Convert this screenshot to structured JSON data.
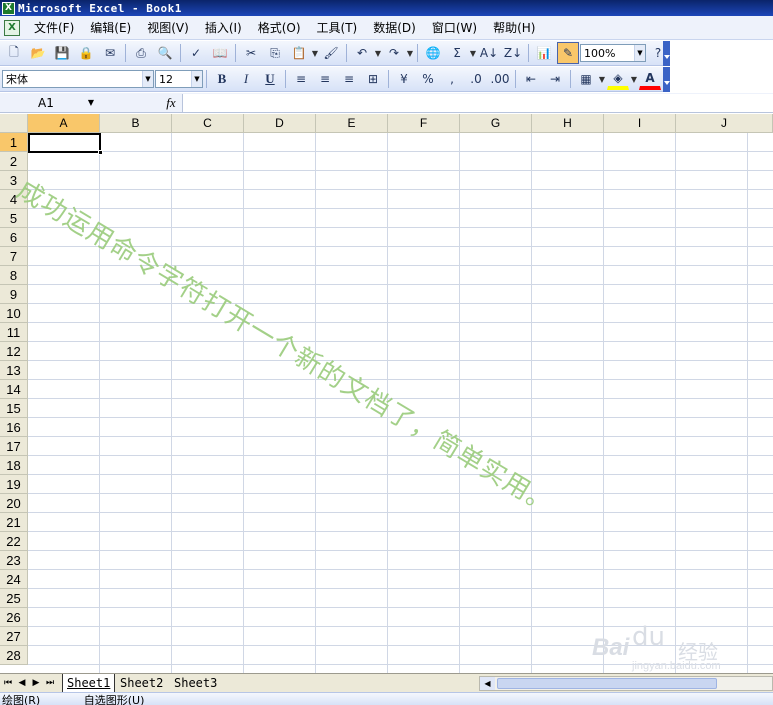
{
  "window": {
    "app_icon": "excel-icon",
    "title": "Microsoft Excel - Book1"
  },
  "menubar": {
    "doc_icon": "workbook-icon",
    "items": [
      "文件(F)",
      "编辑(E)",
      "视图(V)",
      "插入(I)",
      "格式(O)",
      "工具(T)",
      "数据(D)",
      "窗口(W)",
      "帮助(H)"
    ]
  },
  "standard_toolbar": {
    "zoom": "100%",
    "icons": [
      "new-icon",
      "open-icon",
      "save-icon",
      "permission-icon",
      "email-icon",
      "print-icon",
      "print-preview-icon",
      "spelling-icon",
      "research-icon",
      "cut-icon",
      "copy-icon",
      "paste-icon",
      "format-painter-icon",
      "undo-icon",
      "redo-icon",
      "hyperlink-icon",
      "autosum-icon",
      "sort-ascending-icon",
      "sort-descending-icon",
      "chart-wizard-icon",
      "drawing-icon",
      "help-icon"
    ]
  },
  "format_toolbar": {
    "font_name": "宋体",
    "font_size": "12",
    "bold": "B",
    "italic": "I",
    "underline": "U",
    "icons": [
      "align-left-icon",
      "align-center-icon",
      "align-right-icon",
      "merge-center-icon",
      "currency-icon",
      "percent-icon",
      "comma-icon",
      "increase-decimal-icon",
      "decrease-decimal-icon",
      "decrease-indent-icon",
      "increase-indent-icon",
      "borders-icon",
      "fill-color-icon",
      "font-color-icon"
    ],
    "fill_color": "#ffff00",
    "font_color": "#ff0000"
  },
  "formula_bar": {
    "name_box": "A1",
    "fx_label": "fx",
    "content": ""
  },
  "grid": {
    "columns": [
      "A",
      "B",
      "C",
      "D",
      "E",
      "F",
      "G",
      "H",
      "I",
      "J"
    ],
    "rows": [
      "1",
      "2",
      "3",
      "4",
      "5",
      "6",
      "7",
      "8",
      "9",
      "10",
      "11",
      "12",
      "13",
      "14",
      "15",
      "16",
      "17",
      "18",
      "19",
      "20",
      "21",
      "22",
      "23",
      "24",
      "25",
      "26",
      "27",
      "28"
    ],
    "active_cell": "A1"
  },
  "watermark_text": "成功运用命令字符打开一个新的文档了，简单实用。",
  "sheet_tabs": [
    "Sheet1",
    "Sheet2",
    "Sheet3"
  ],
  "active_sheet": "Sheet1",
  "drawing_toolbar": {
    "draw_label": "绘图(R)",
    "autoshapes_label": "自选图形(U)"
  },
  "baidu_watermark": {
    "logo": "Bai",
    "paw": "du",
    "brand": "经验",
    "url": "jingyan.baidu.com"
  },
  "colors": {
    "title_bar": "#0a246a",
    "selected_header": "#f9c76a",
    "watermark": "#9acc7c"
  }
}
